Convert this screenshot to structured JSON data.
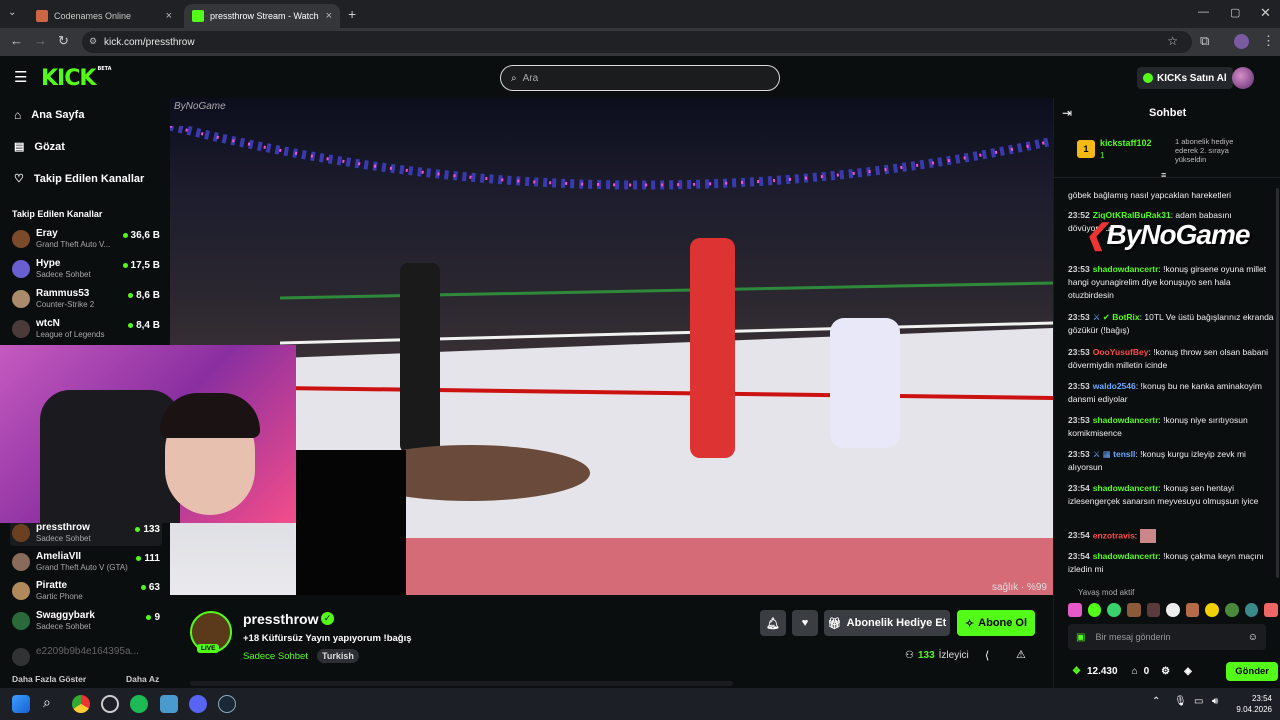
{
  "browser": {
    "tabs": [
      {
        "title": "Codenames Online",
        "active": false
      },
      {
        "title": "pressthrow Stream - Watch Live",
        "active": true
      }
    ],
    "url": "kick.com/pressthrow"
  },
  "header": {
    "logo": "KICK",
    "logo_badge": "BETA",
    "search_placeholder": "Ara",
    "kicks_button": "KICKs Satın Al"
  },
  "sidebar": {
    "nav": [
      {
        "label": "Ana Sayfa",
        "icon": "home-icon"
      },
      {
        "label": "Gözat",
        "icon": "browse-icon"
      },
      {
        "label": "Takip Edilen Kanallar",
        "icon": "heart-icon"
      }
    ],
    "followed_title": "Takip Edilen Kanallar",
    "followed": [
      {
        "name": "Eray",
        "category": "Grand Theft Auto V...",
        "viewers": "36,6 B",
        "color": "#7a4a2a"
      },
      {
        "name": "Hype",
        "category": "Sadece Sohbet",
        "viewers": "17,5 B",
        "color": "#6a5fd0"
      },
      {
        "name": "Rammus53",
        "category": "Counter-Strike 2",
        "viewers": "8,6 B",
        "color": "#a98a6a"
      },
      {
        "name": "wtcN",
        "category": "League of Legends",
        "viewers": "8,4 B",
        "color": "#4a3a3a"
      }
    ],
    "recommended": [
      {
        "name": "pressthrow",
        "category": "Sadece Sohbet",
        "viewers": "133",
        "color": "#6a4020"
      },
      {
        "name": "AmeliaVII",
        "category": "Grand Theft Auto V (GTA)",
        "viewers": "111",
        "color": "#8a6a5a"
      },
      {
        "name": "Piratte",
        "category": "Gartic Phone",
        "viewers": "63",
        "color": "#b08a5a"
      },
      {
        "name": "Swaggybark",
        "category": "Sadece Sohbet",
        "viewers": "9",
        "color": "#2a6a3a"
      }
    ],
    "faded_channel": "e2209b9b4e164395a...",
    "show_more": "Daha Fazla Göster",
    "show_less": "Daha Az"
  },
  "video": {
    "watermark_top": "ByNoGame",
    "watermark_bottom": "sağlık · %99"
  },
  "stream": {
    "channel": "pressthrow",
    "live_badge": "LIVE",
    "title": "+18 Küfürsüz Yayın yapıyorum !bağış",
    "category": "Sadece Sohbet",
    "tag": "Turkish",
    "gift_button": "Abonelik Hediye Et",
    "subscribe_button": "Abone Ol",
    "viewers": "133",
    "viewers_label": "İzleyici"
  },
  "chat": {
    "title": "Sohbet",
    "pinned": {
      "rank": "1",
      "user": "kickstaff102",
      "count": "1",
      "text": "1 abonelik hediye ederek 2. sıraya yükseldin"
    },
    "overlay_logo": "ByNoGame",
    "messages": [
      {
        "time": "",
        "user": "",
        "color": "#ffffff",
        "text": "göbek bağlamış nasıl yapcaklan hareketleri"
      },
      {
        "time": "23:52",
        "user": "ZiqOtKRalBuRak31",
        "color": "#53fc18",
        "text": "adam babasını dövüyormuş"
      },
      {
        "time": "23:53",
        "user": "shadowdancertr",
        "color": "#53fc18",
        "text": "!konuş girsene oyuna millet hangi oyunagirelim diye konuşuyo sen hala otuzbirdesin"
      },
      {
        "time": "23:53",
        "user": "BotRix",
        "color": "#53fc18",
        "text": "10TL Ve üstü bağışlarınız ekranda gözükür (!bağış)"
      },
      {
        "time": "23:53",
        "user": "OooYusufBey",
        "color": "#ff4a4a",
        "text": "!konuş throw sen olsan babani dövermiydin milletin icinde"
      },
      {
        "time": "23:53",
        "user": "waldo2546",
        "color": "#6aa8ff",
        "text": "!konuş bu ne kanka aminakoyim dansmi ediyolar"
      },
      {
        "time": "23:53",
        "user": "shadowdancertr",
        "color": "#53fc18",
        "text": "!konuş niye sırıtıyosun komikmisence"
      },
      {
        "time": "23:53",
        "user": "tensll",
        "color": "#6aa8ff",
        "text": "!konuş kurgu izleyip zevk mi alıyorsun"
      },
      {
        "time": "23:54",
        "user": "shadowdancertr",
        "color": "#53fc18",
        "text": "!konuş sen hentayi izlesengerçek sanarsın meyvesuyu olmuşsun iyice"
      },
      {
        "time": "23:54",
        "user": "enzotravis",
        "color": "#ff4a4a",
        "text": ""
      },
      {
        "time": "23:54",
        "user": "shadowdancertr",
        "color": "#53fc18",
        "text": "!konuş çakma keyn maçını izledin mi"
      }
    ],
    "slow_mode": "Yavaş mod aktif",
    "input_placeholder": "Bir mesaj gönderin",
    "points": "12.430",
    "gift_count": "0",
    "send_button": "Gönder"
  },
  "taskbar": {
    "time": "23:54",
    "date": "9.04.2026"
  }
}
